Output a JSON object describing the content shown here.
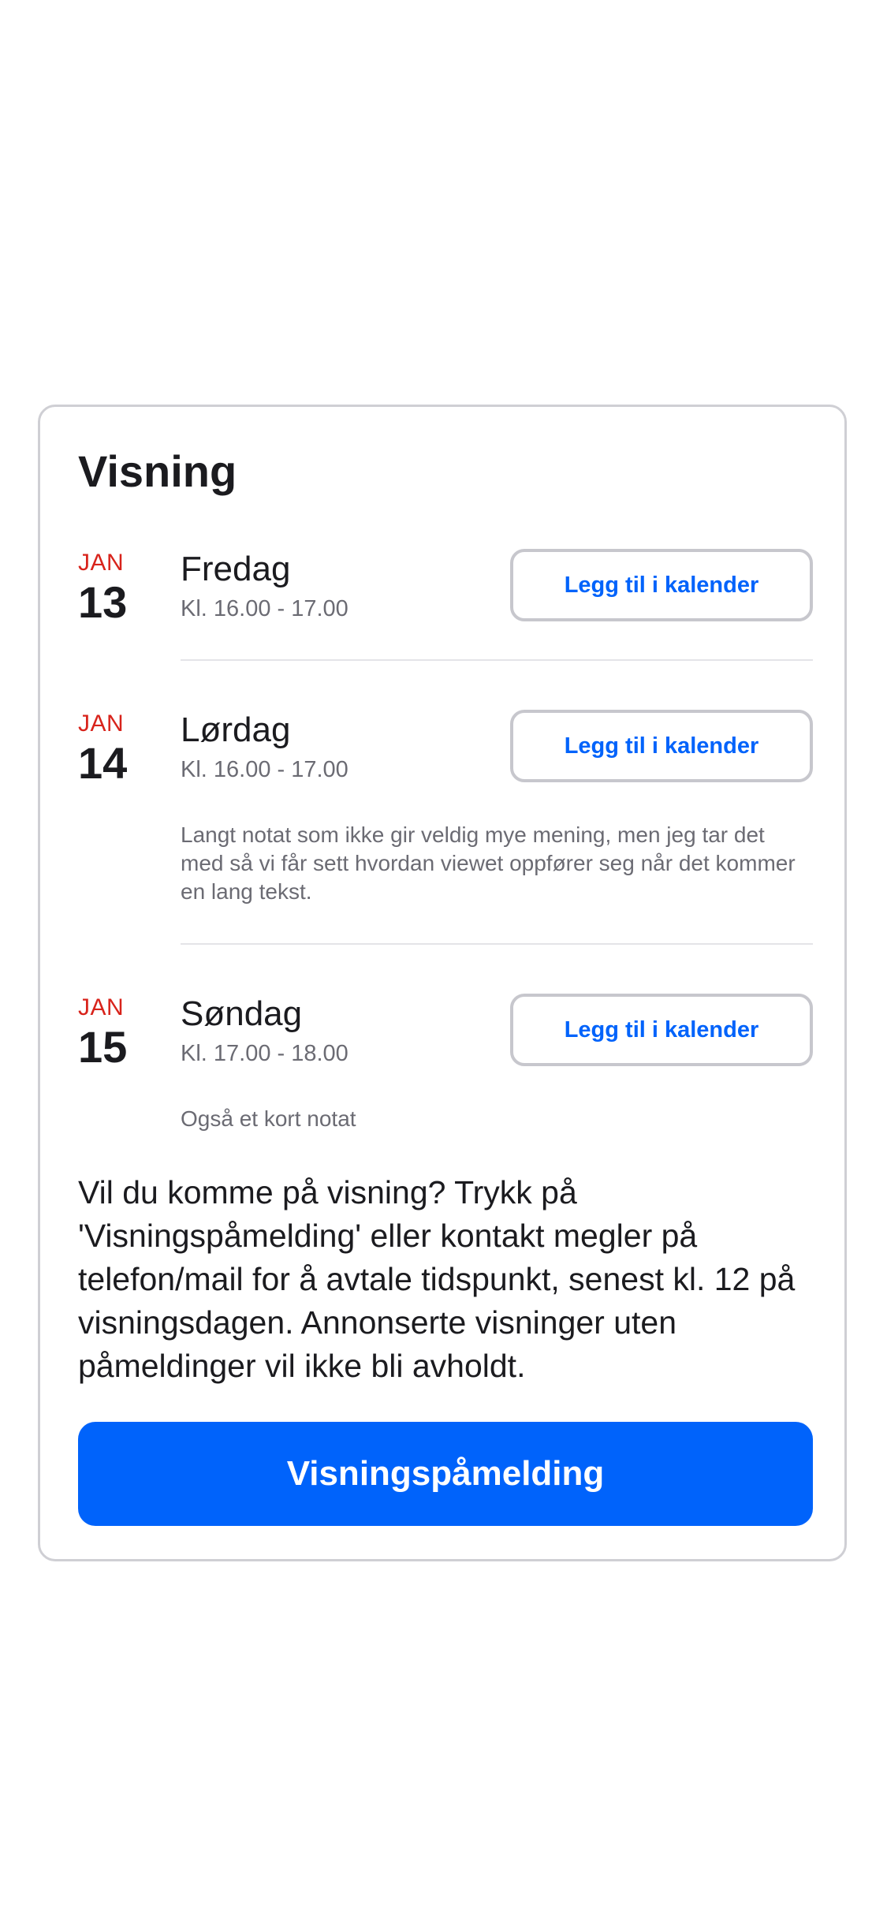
{
  "section": {
    "title": "Visning"
  },
  "events": [
    {
      "month": "JAN",
      "day": "13",
      "weekday": "Fredag",
      "time": "Kl. 16.00 - 17.00",
      "calendar_label": "Legg til i kalender",
      "note": ""
    },
    {
      "month": "JAN",
      "day": "14",
      "weekday": "Lørdag",
      "time": "Kl. 16.00 - 17.00",
      "calendar_label": "Legg til i kalender",
      "note": "Langt notat som ikke gir veldig mye mening, men jeg tar det med så vi får sett hvordan viewet oppfører seg når det kommer en lang tekst."
    },
    {
      "month": "JAN",
      "day": "15",
      "weekday": "Søndag",
      "time": "Kl. 17.00 - 18.00",
      "calendar_label": "Legg til i kalender",
      "note": "Også et kort notat"
    }
  ],
  "info_text": "Vil du komme på visning? Trykk på 'Visningspåmelding' eller kontakt megler på telefon/mail for å avtale tidspunkt, senest kl. 12 på visningsdagen. Annonserte visninger uten påmeldinger vil ikke bli avholdt.",
  "primary_button": {
    "label": "Visningspåmelding"
  },
  "colors": {
    "accent": "#0063fb",
    "month": "#d8231b",
    "border": "#cfcfd4",
    "muted_text": "#6b6b73"
  }
}
